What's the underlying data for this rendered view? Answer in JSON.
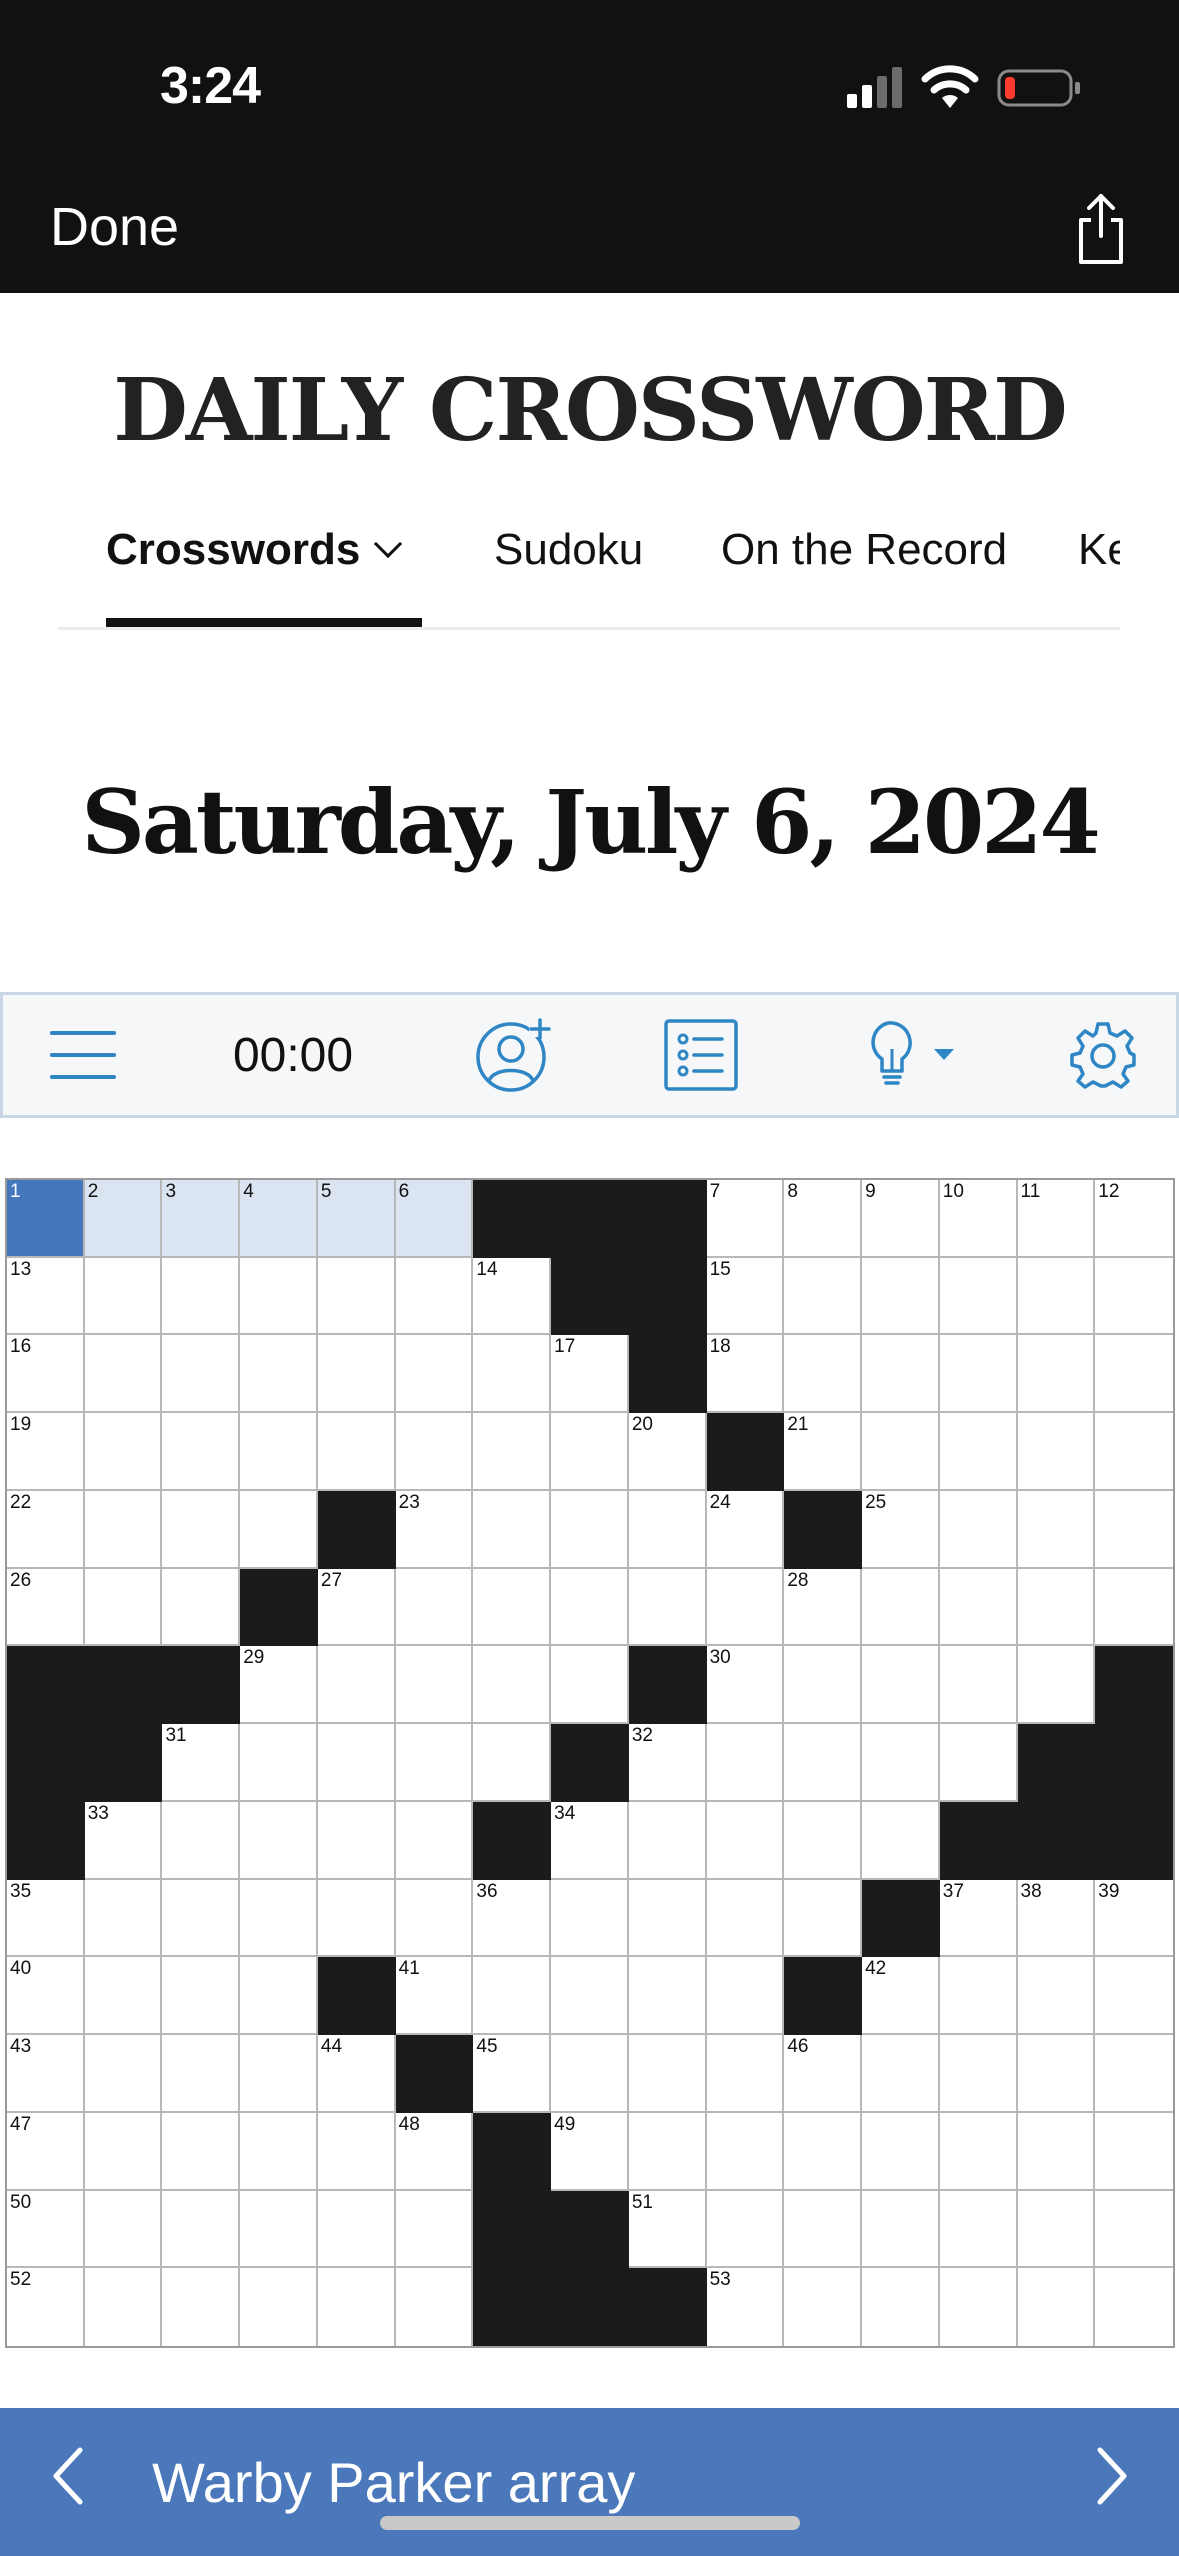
{
  "status": {
    "time": "3:24"
  },
  "topbar": {
    "done_label": "Done"
  },
  "brand": {
    "title": "DAILY CROSSWORD"
  },
  "nav": {
    "items": [
      {
        "label": "Crosswords",
        "active": true
      },
      {
        "label": "Sudoku"
      },
      {
        "label": "On the Record"
      },
      {
        "label": "Ke"
      }
    ]
  },
  "puzzle": {
    "date": "Saturday, July 6, 2024"
  },
  "toolbar": {
    "timer": "00:00",
    "icons": [
      "menu-icon",
      "add-player-icon",
      "clue-list-icon",
      "hint-lightbulb-icon",
      "settings-gear-icon"
    ]
  },
  "grid": {
    "size": 15,
    "black_cells": [
      [
        0,
        6
      ],
      [
        0,
        7
      ],
      [
        0,
        8
      ],
      [
        1,
        7
      ],
      [
        1,
        8
      ],
      [
        2,
        8
      ],
      [
        3,
        9
      ],
      [
        4,
        4
      ],
      [
        4,
        10
      ],
      [
        5,
        3
      ],
      [
        6,
        0
      ],
      [
        6,
        1
      ],
      [
        6,
        2
      ],
      [
        6,
        8
      ],
      [
        6,
        14
      ],
      [
        7,
        0
      ],
      [
        7,
        1
      ],
      [
        7,
        7
      ],
      [
        7,
        13
      ],
      [
        7,
        14
      ],
      [
        8,
        0
      ],
      [
        8,
        6
      ],
      [
        8,
        12
      ],
      [
        8,
        13
      ],
      [
        8,
        14
      ],
      [
        9,
        11
      ],
      [
        10,
        4
      ],
      [
        10,
        10
      ],
      [
        11,
        5
      ],
      [
        12,
        6
      ],
      [
        13,
        6
      ],
      [
        13,
        7
      ],
      [
        14,
        6
      ],
      [
        14,
        7
      ],
      [
        14,
        8
      ]
    ],
    "numbers": [
      [
        0,
        0,
        "1"
      ],
      [
        0,
        1,
        "2"
      ],
      [
        0,
        2,
        "3"
      ],
      [
        0,
        3,
        "4"
      ],
      [
        0,
        4,
        "5"
      ],
      [
        0,
        5,
        "6"
      ],
      [
        0,
        9,
        "7"
      ],
      [
        0,
        10,
        "8"
      ],
      [
        0,
        11,
        "9"
      ],
      [
        0,
        12,
        "10"
      ],
      [
        0,
        13,
        "11"
      ],
      [
        0,
        14,
        "12"
      ],
      [
        1,
        0,
        "13"
      ],
      [
        1,
        6,
        "14"
      ],
      [
        1,
        9,
        "15"
      ],
      [
        2,
        0,
        "16"
      ],
      [
        2,
        7,
        "17"
      ],
      [
        2,
        9,
        "18"
      ],
      [
        3,
        0,
        "19"
      ],
      [
        3,
        8,
        "20"
      ],
      [
        3,
        10,
        "21"
      ],
      [
        4,
        0,
        "22"
      ],
      [
        4,
        5,
        "23"
      ],
      [
        4,
        9,
        "24"
      ],
      [
        4,
        11,
        "25"
      ],
      [
        5,
        0,
        "26"
      ],
      [
        5,
        4,
        "27"
      ],
      [
        5,
        10,
        "28"
      ],
      [
        6,
        3,
        "29"
      ],
      [
        6,
        9,
        "30"
      ],
      [
        7,
        2,
        "31"
      ],
      [
        7,
        8,
        "32"
      ],
      [
        8,
        1,
        "33"
      ],
      [
        8,
        7,
        "34"
      ],
      [
        9,
        0,
        "35"
      ],
      [
        9,
        6,
        "36"
      ],
      [
        9,
        12,
        "37"
      ],
      [
        9,
        13,
        "38"
      ],
      [
        9,
        14,
        "39"
      ],
      [
        10,
        0,
        "40"
      ],
      [
        10,
        5,
        "41"
      ],
      [
        10,
        11,
        "42"
      ],
      [
        11,
        0,
        "43"
      ],
      [
        11,
        4,
        "44"
      ],
      [
        11,
        6,
        "45"
      ],
      [
        11,
        10,
        "46"
      ],
      [
        12,
        0,
        "47"
      ],
      [
        12,
        5,
        "48"
      ],
      [
        12,
        7,
        "49"
      ],
      [
        13,
        0,
        "50"
      ],
      [
        13,
        8,
        "51"
      ],
      [
        14,
        0,
        "52"
      ],
      [
        14,
        9,
        "53"
      ]
    ],
    "selected_cell": [
      0,
      0
    ],
    "highlighted_cells": [
      [
        0,
        1
      ],
      [
        0,
        2
      ],
      [
        0,
        3
      ],
      [
        0,
        4
      ],
      [
        0,
        5
      ]
    ]
  },
  "clue": {
    "text": "Warby Parker array"
  },
  "colors": {
    "accent_blue": "#4a78bb",
    "icon_blue": "#2f86c4",
    "selected_cell": "#4577bd",
    "highlighted_cell": "#dbe5f1",
    "black_cell": "#1b1b1b"
  }
}
